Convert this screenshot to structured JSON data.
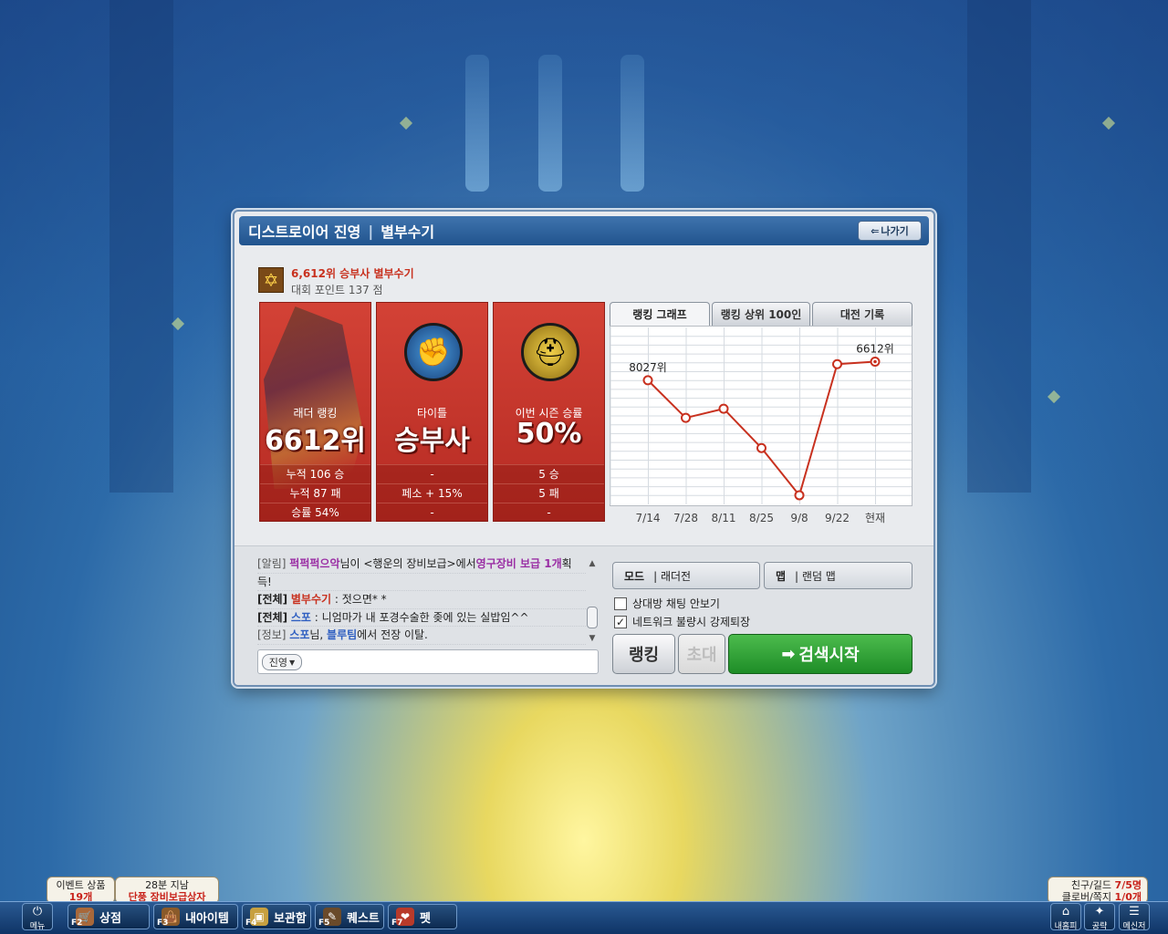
{
  "window": {
    "camp": "디스트로이어 진영",
    "separator": "|",
    "character": "별부수기",
    "exit_label": "나가기"
  },
  "rank_header": {
    "title": "6,612위 승부사 별부수기",
    "points": "대회 포인트 137 점"
  },
  "cards": {
    "ladder": {
      "label": "래더 랭킹",
      "value": "6612위",
      "stats": [
        "누적 106 승",
        "누적 87 패",
        "승률 54%"
      ]
    },
    "title": {
      "label": "타이틀",
      "value": "승부사",
      "stats": [
        "-",
        "페소 + 15%",
        "-"
      ]
    },
    "season": {
      "label": "이번 시즌 승률",
      "value": "50%",
      "stats": [
        "5 승",
        "5 패",
        "-"
      ]
    }
  },
  "tabs": [
    "랭킹 그래프",
    "랭킹 상위 100인",
    "대전 기록"
  ],
  "chart_data": {
    "type": "line",
    "categories": [
      "7/14",
      "7/28",
      "8/11",
      "8/25",
      "9/8",
      "9/22",
      "현재"
    ],
    "values": [
      8027,
      10900,
      10200,
      13200,
      16800,
      6800,
      6612
    ],
    "annotations": [
      {
        "index": 0,
        "text": "8027위"
      },
      {
        "index": 6,
        "text": "6612위"
      }
    ],
    "ylim": [
      4000,
      17500
    ],
    "inverted_y": true,
    "grid": true,
    "line_color": "#c8311f"
  },
  "chat": {
    "lines": [
      {
        "tag": "[알림]",
        "parts": [
          {
            "t": " ",
            "c": ""
          },
          {
            "t": "퍽퍽퍽으악",
            "c": "nm-purple"
          },
          {
            "t": "님이 <행운의 장비보급>에서",
            "c": ""
          },
          {
            "t": "영구장비 보급 1개",
            "c": "nm-purple"
          },
          {
            "t": "획",
            "c": ""
          }
        ]
      },
      {
        "tag": "",
        "parts": [
          {
            "t": "    득!",
            "c": ""
          }
        ]
      },
      {
        "tag": "[전체]",
        "parts": [
          {
            "t": " ",
            "c": ""
          },
          {
            "t": "별부수기",
            "c": "nm-red"
          },
          {
            "t": " : 젓으면* *",
            "c": ""
          }
        ]
      },
      {
        "tag": "[전체]",
        "parts": [
          {
            "t": " ",
            "c": ""
          },
          {
            "t": "스포",
            "c": "nm-blue"
          },
          {
            "t": " : 니엄마가 내 포경수술한 좆에 있는 실밥임^^",
            "c": ""
          }
        ]
      },
      {
        "tag": "[정보]",
        "parts": [
          {
            "t": " ",
            "c": ""
          },
          {
            "t": "스포",
            "c": "nm-blue"
          },
          {
            "t": "님, ",
            "c": ""
          },
          {
            "t": "블루팀",
            "c": "nm-blue"
          },
          {
            "t": "에서 전장 이탈.",
            "c": ""
          }
        ]
      }
    ],
    "channel": "진영"
  },
  "match": {
    "mode_key": "모드",
    "mode_value": "| 래더전",
    "map_key": "맵",
    "map_value": "| 랜덤 맵",
    "check_chat": "상대방 채팅 안보기",
    "check_chat_checked": false,
    "check_network": "네트워크 불량시 강제퇴장",
    "check_network_checked": true,
    "btn_ranking": "랭킹",
    "btn_invite": "초대",
    "btn_search": "검색시작"
  },
  "taskbar": {
    "menu": "메뉴",
    "shop": "상점",
    "my_items": "내아이템",
    "storage": "보관함",
    "quest": "퀘스트",
    "pet": "펫",
    "my_info": "내홈피",
    "guide": "공략",
    "messenger": "메신저",
    "fkeys": [
      "F2",
      "F3",
      "F4",
      "F5",
      "F7"
    ]
  },
  "notices": {
    "event_label": "이벤트 상품",
    "event_count": "19개",
    "time_label": "28분 지남",
    "time_box": "단풍 장비보급상자",
    "friends_label": "친구/길드",
    "friends_value": "7/5명",
    "clover_label": "클로버/쪽지",
    "clover_value": "1/0개"
  }
}
